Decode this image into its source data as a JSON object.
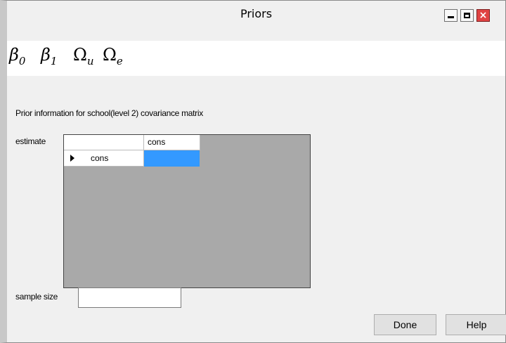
{
  "window": {
    "title": "Priors"
  },
  "tabs": [
    {
      "symbol": "β",
      "subscript": "0"
    },
    {
      "symbol": "β",
      "subscript": "1"
    },
    {
      "symbol": "Ω",
      "subscript": "u"
    },
    {
      "symbol": "Ω",
      "subscript": "e"
    }
  ],
  "main": {
    "heading": "Prior information for school(level 2) covariance matrix",
    "estimate_label": "estimate",
    "sample_size_label": "sample size",
    "sample_size_value": ""
  },
  "grid": {
    "column_headers": [
      "cons"
    ],
    "rows": [
      {
        "label": "cons",
        "values": [
          ""
        ]
      }
    ],
    "selected_cell_color": "#3399ff"
  },
  "buttons": {
    "done": "Done",
    "help": "Help"
  },
  "colors": {
    "close_button": "#e04343"
  }
}
